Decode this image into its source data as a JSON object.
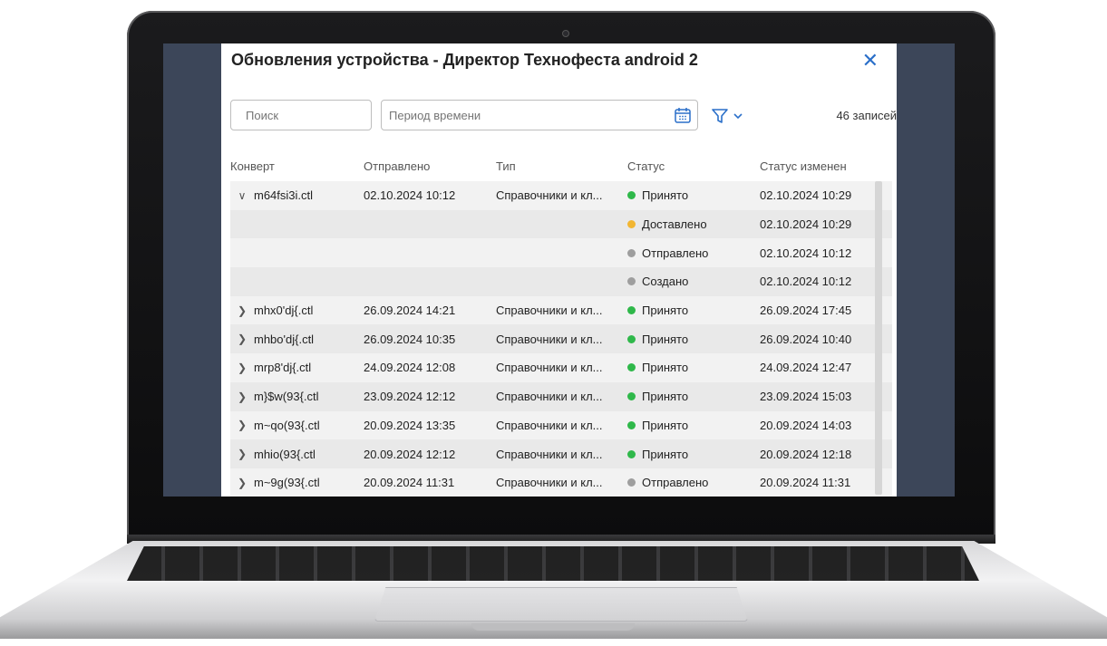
{
  "dialog": {
    "title": "Обновления устройства - Директор Технофеста android 2",
    "close_label": "✕"
  },
  "toolbar": {
    "search_placeholder": "Поиск",
    "period_placeholder": "Период времени",
    "records_count": "46 записей"
  },
  "table": {
    "headers": {
      "envelope": "Конверт",
      "sent": "Отправлено",
      "type": "Тип",
      "status": "Статус",
      "status_changed": "Статус изменен"
    },
    "rows": [
      {
        "chevron": "expanded",
        "envelope": "m64fsi3i.ctl",
        "sent": "02.10.2024 10:12",
        "type": "Справочники и кл...",
        "status": "Принято",
        "status_color": "#2fb84a",
        "changed": "02.10.2024 10:29"
      },
      {
        "chevron": "",
        "envelope": "",
        "sent": "",
        "type": "",
        "status": "Доставлено",
        "status_color": "#f2b632",
        "changed": "02.10.2024 10:29"
      },
      {
        "chevron": "",
        "envelope": "",
        "sent": "",
        "type": "",
        "status": "Отправлено",
        "status_color": "#9e9e9e",
        "changed": "02.10.2024 10:12"
      },
      {
        "chevron": "",
        "envelope": "",
        "sent": "",
        "type": "",
        "status": "Создано",
        "status_color": "#9e9e9e",
        "changed": "02.10.2024 10:12"
      },
      {
        "chevron": "collapsed",
        "envelope": "mhx0'dj{.ctl",
        "sent": "26.09.2024 14:21",
        "type": "Справочники и кл...",
        "status": "Принято",
        "status_color": "#2fb84a",
        "changed": "26.09.2024 17:45"
      },
      {
        "chevron": "collapsed",
        "envelope": "mhbo'dj{.ctl",
        "sent": "26.09.2024 10:35",
        "type": "Справочники и кл...",
        "status": "Принято",
        "status_color": "#2fb84a",
        "changed": "26.09.2024 10:40"
      },
      {
        "chevron": "collapsed",
        "envelope": "mrp8'dj{.ctl",
        "sent": "24.09.2024 12:08",
        "type": "Справочники и кл...",
        "status": "Принято",
        "status_color": "#2fb84a",
        "changed": "24.09.2024 12:47"
      },
      {
        "chevron": "collapsed",
        "envelope": "m}$w(93{.ctl",
        "sent": "23.09.2024 12:12",
        "type": "Справочники и кл...",
        "status": "Принято",
        "status_color": "#2fb84a",
        "changed": "23.09.2024 15:03"
      },
      {
        "chevron": "collapsed",
        "envelope": "m~qo(93{.ctl",
        "sent": "20.09.2024 13:35",
        "type": "Справочники и кл...",
        "status": "Принято",
        "status_color": "#2fb84a",
        "changed": "20.09.2024 14:03"
      },
      {
        "chevron": "collapsed",
        "envelope": "mhio(93{.ctl",
        "sent": "20.09.2024 12:12",
        "type": "Справочники и кл...",
        "status": "Принято",
        "status_color": "#2fb84a",
        "changed": "20.09.2024 12:18"
      },
      {
        "chevron": "collapsed",
        "envelope": "m~9g(93{.ctl",
        "sent": "20.09.2024 11:31",
        "type": "Справочники и кл...",
        "status": "Отправлено",
        "status_color": "#9e9e9e",
        "changed": "20.09.2024 11:31"
      }
    ]
  }
}
